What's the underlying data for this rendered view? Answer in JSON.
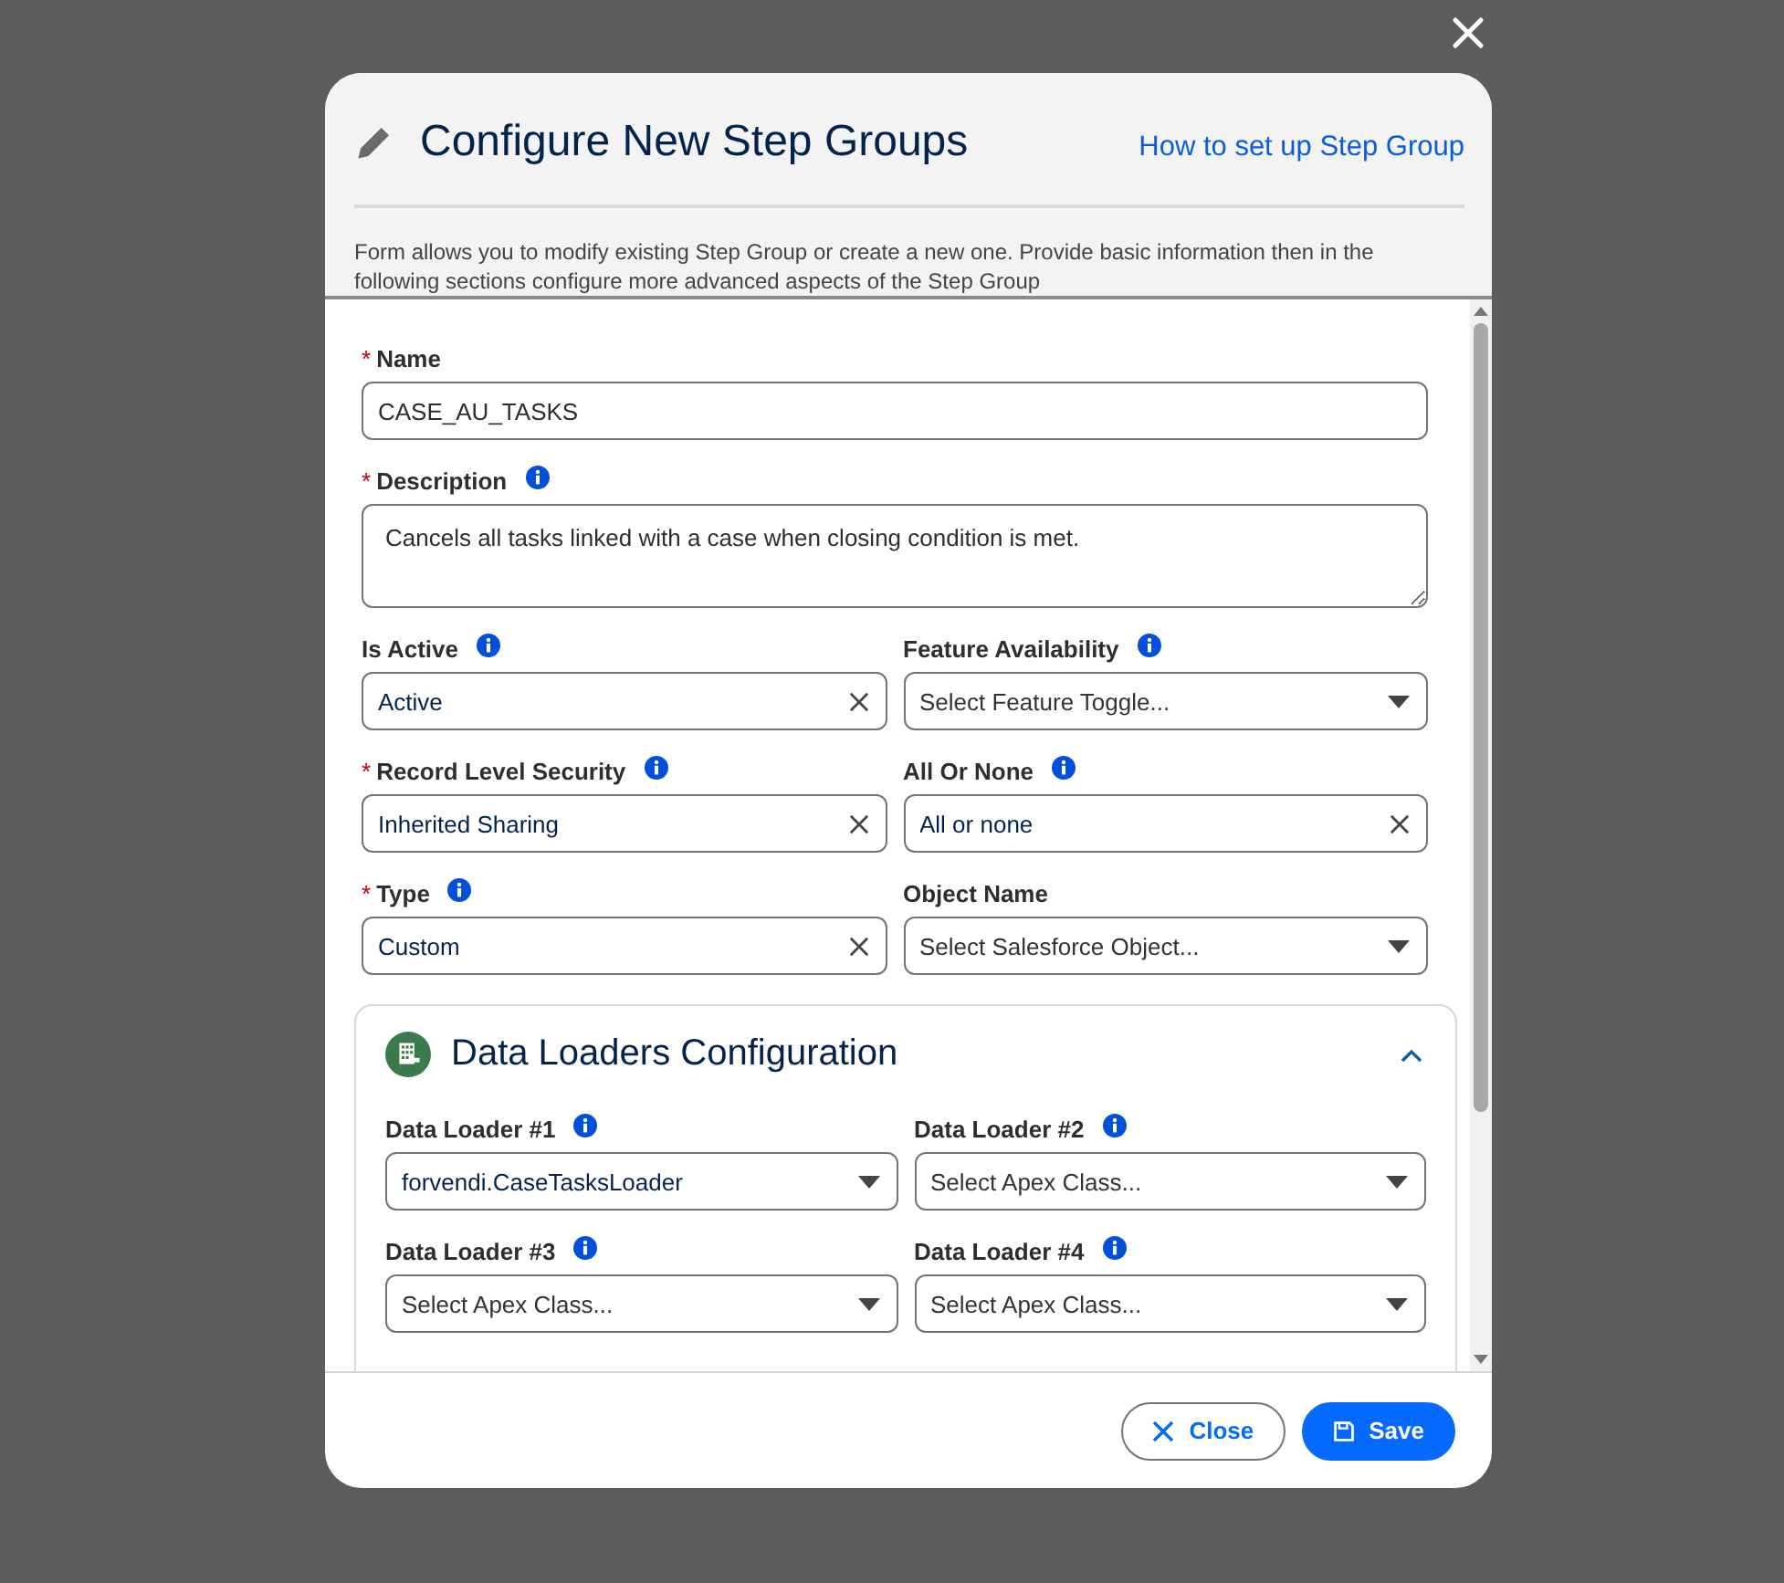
{
  "modal": {
    "title": "Configure New Step Groups",
    "help_link": "How to set up Step Group",
    "description": "Form allows you to modify existing Step Group or create a new one. Provide basic information then in the following sections configure more advanced aspects of the Step Group"
  },
  "fields": [
    {
      "label": "Name",
      "required_mark": "*",
      "info": false,
      "kind": "text",
      "value": "CASE_AU_TASKS"
    },
    {
      "label": "Description",
      "required_mark": "*",
      "info": true,
      "kind": "textarea",
      "value": "Cancels all tasks linked with a case when closing condition is met."
    },
    {
      "label": "Is Active",
      "info": true,
      "kind": "clearable",
      "value": "Active"
    },
    {
      "label": "Feature Availability",
      "info": true,
      "kind": "dropdown",
      "placeholder": "Select Feature Toggle..."
    },
    {
      "label": "Record Level Security",
      "required_mark": "*",
      "info": true,
      "kind": "clearable",
      "value": "Inherited Sharing"
    },
    {
      "label": "All Or None",
      "info": true,
      "kind": "clearable",
      "value": "All or none"
    },
    {
      "label": "Type",
      "required_mark": "*",
      "info": true,
      "kind": "clearable",
      "value": "Custom"
    },
    {
      "label": "Object Name",
      "info": false,
      "kind": "dropdown",
      "placeholder": "Select Salesforce Object..."
    }
  ],
  "section": {
    "title": "Data Loaders Configuration",
    "expanded": true,
    "fields": [
      {
        "label": "Data Loader #1",
        "info": true,
        "kind": "dropdown",
        "value": "forvendi.CaseTasksLoader"
      },
      {
        "label": "Data Loader #2",
        "info": true,
        "kind": "dropdown",
        "placeholder": "Select Apex Class..."
      },
      {
        "label": "Data Loader #3",
        "info": true,
        "kind": "dropdown",
        "placeholder": "Select Apex Class..."
      },
      {
        "label": "Data Loader #4",
        "info": true,
        "kind": "dropdown",
        "placeholder": "Select Apex Class..."
      }
    ]
  },
  "buttons": [
    {
      "label": "Close",
      "kind": "neutral"
    },
    {
      "label": "Save",
      "kind": "brand"
    }
  ]
}
